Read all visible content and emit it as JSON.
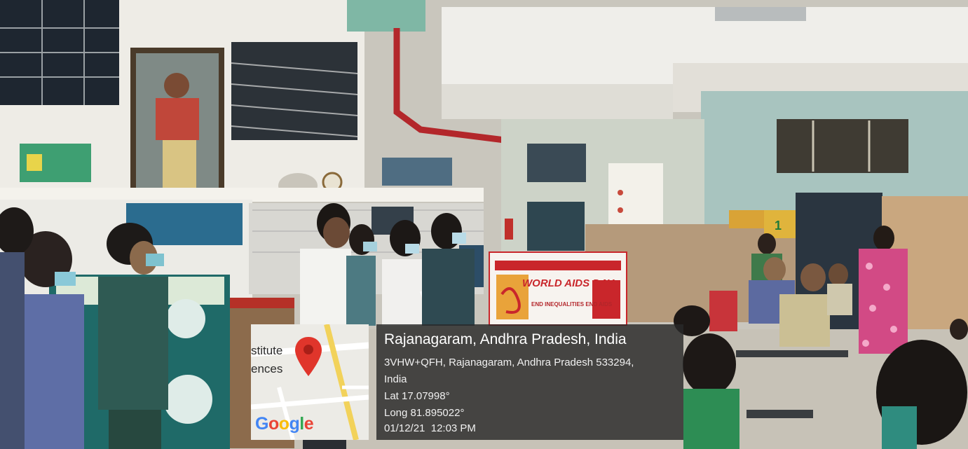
{
  "banner": {
    "title": "WORLD AIDS DAY",
    "subtitle": "END INEQUALITIES END AIDS"
  },
  "map_overlay": {
    "fragment_line1": "stitute",
    "fragment_line2": "ences",
    "logo_letters": [
      "G",
      "o",
      "o",
      "g",
      "l",
      "e"
    ],
    "logo_colors": [
      "#4285f4",
      "#ea4335",
      "#fbbc05",
      "#4285f4",
      "#34a853",
      "#ea4335"
    ],
    "pin_icon": "map-pin-icon"
  },
  "location": {
    "title": "Rajanagaram, Andhra Pradesh, India",
    "address_line1": "3VHW+QFH, Rajanagaram, Andhra Pradesh 533294,",
    "address_line2": "India",
    "lat": "Lat 17.07998°",
    "long": "Long 81.895022°",
    "datetime": "01/12/21  12:03 PM"
  },
  "signs": {
    "side_stand_number": "1"
  }
}
